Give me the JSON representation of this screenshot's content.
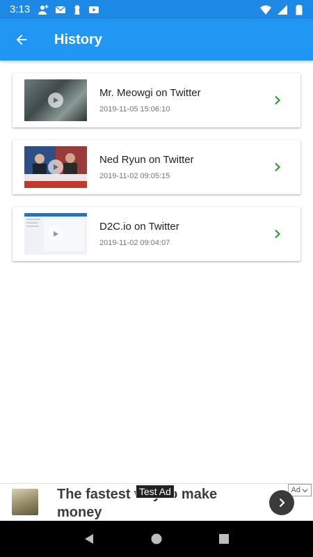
{
  "status_bar": {
    "time": "3:13",
    "left_icons": [
      "add-person-icon",
      "mail-icon",
      "keyhole-icon",
      "youtube-icon"
    ],
    "right_icons": [
      "wifi-icon",
      "signal-icon",
      "battery-icon"
    ]
  },
  "app_bar": {
    "title": "History",
    "back_icon": "arrow-back-icon",
    "background": "#2196f3"
  },
  "history": {
    "items": [
      {
        "title": "Mr. Meowgi on Twitter",
        "date": "2019-11-05 15:06:10"
      },
      {
        "title": "Ned Ryun on Twitter",
        "date": "2019-11-02 09:05:15"
      },
      {
        "title": "D2C.io on Twitter",
        "date": "2019-11-02 09:04:07"
      }
    ],
    "chevron_color": "#2e9b2e"
  },
  "ad": {
    "headline": "The fastest way to make money",
    "test_label": "Test Ad",
    "choice_label": "Ad"
  },
  "nav_bar": {
    "buttons": [
      "back-triangle-icon",
      "home-circle-icon",
      "recents-square-icon"
    ]
  }
}
